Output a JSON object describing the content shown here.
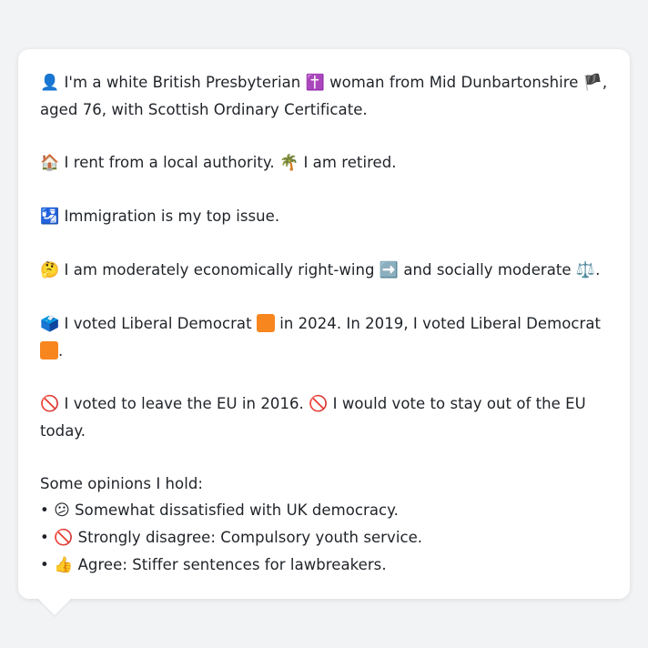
{
  "profile": {
    "identity": {
      "icon_person": "👤",
      "text1": " I'm a white British Presbyterian ",
      "icon_cross": "✝️",
      "text2": " woman from Mid Dunbartonshire ",
      "icon_flag": "🏴",
      "text3": ", aged 76, with Scottish Ordinary Certificate."
    },
    "housing": {
      "icon_house": "🏠",
      "text1": " I rent from a local authority. ",
      "icon_palm": "🌴",
      "text2": " I am retired."
    },
    "issue": {
      "icon_arrow": "🛂",
      "text": " Immigration is my top issue."
    },
    "politics": {
      "icon_think": "🤔",
      "text1": " I am moderately economically right-wing ",
      "icon_right": "➡️",
      "text2": " and socially moderate ",
      "icon_scale": "⚖️",
      "text3": "."
    },
    "votes": {
      "icon_ballot": "🗳️",
      "text1": " I voted Liberal Democrat ",
      "text2": " in 2024. In 2019, I voted Liberal Democrat ",
      "text3": ".",
      "libdem_color": "#f7861f"
    },
    "eu": {
      "icon_no1": "🚫",
      "text1": " I voted to leave the EU in 2016. ",
      "icon_no2": "🚫",
      "text2": " I would vote to stay out of the EU today."
    },
    "opinions": {
      "heading": "Some opinions I hold:",
      "items": [
        {
          "bullet": "• ",
          "icon": "😕",
          "text": " Somewhat dissatisfied with UK democracy."
        },
        {
          "bullet": "• ",
          "icon": "🚫",
          "text": " Strongly disagree: Compulsory youth service."
        },
        {
          "bullet": "• ",
          "icon": "👍",
          "text": " Agree: Stiffer sentences for lawbreakers."
        }
      ]
    }
  }
}
